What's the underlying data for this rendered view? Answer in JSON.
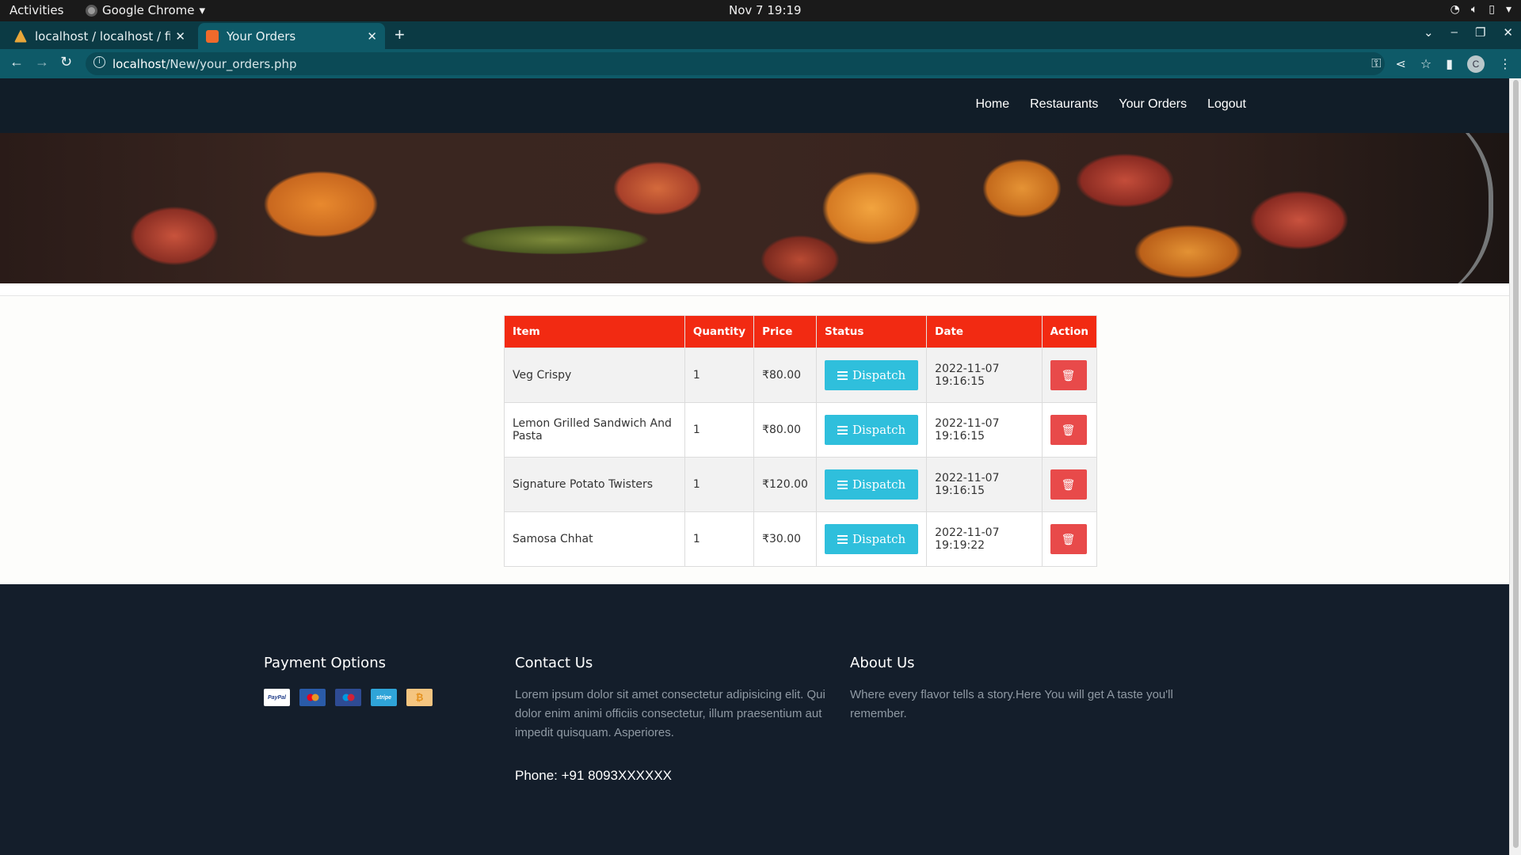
{
  "os_bar": {
    "activities": "Activities",
    "app_name": "Google Chrome",
    "clock": "Nov 7  19:19"
  },
  "browser": {
    "tabs": [
      {
        "title": "localhost / localhost / fin_",
        "active": false
      },
      {
        "title": "Your Orders",
        "active": true
      }
    ],
    "url_host": "localhost",
    "url_path": "/New/your_orders.php"
  },
  "nav": {
    "items": [
      "Home",
      "Restaurants",
      "Your Orders",
      "Logout"
    ]
  },
  "table": {
    "headers": [
      "Item",
      "Quantity",
      "Price",
      "Status",
      "Date",
      "Action"
    ],
    "rows": [
      {
        "item": "Veg Crispy",
        "quantity": "1",
        "price": "₹80.00",
        "status": "Dispatch",
        "date": "2022-11-07 19:16:15"
      },
      {
        "item": "Lemon Grilled Sandwich And Pasta",
        "quantity": "1",
        "price": "₹80.00",
        "status": "Dispatch",
        "date": "2022-11-07 19:16:15"
      },
      {
        "item": "Signature Potato Twisters",
        "quantity": "1",
        "price": "₹120.00",
        "status": "Dispatch",
        "date": "2022-11-07 19:16:15"
      },
      {
        "item": "Samosa Chhat",
        "quantity": "1",
        "price": "₹30.00",
        "status": "Dispatch",
        "date": "2022-11-07 19:19:22"
      }
    ]
  },
  "footer": {
    "payment_title": "Payment Options",
    "payment_cards": [
      {
        "name": "PayPal",
        "color": "#ffffff"
      },
      {
        "name": "mastercard",
        "color": "#2a5ba8"
      },
      {
        "name": "maestro",
        "color": "#2e4b93"
      },
      {
        "name": "stripe",
        "color": "#2fa4d8"
      },
      {
        "name": "bitcoin",
        "color": "#f5c580"
      }
    ],
    "contact_title": "Contact Us",
    "contact_text": "Lorem ipsum dolor sit amet consectetur adipisicing elit. Qui dolor enim animi officiis consectetur, illum praesentium aut impedit quisquam. Asperiores.",
    "phone": "Phone: +91 8093XXXXXX",
    "about_title": "About Us",
    "about_text": "Where every flavor tells a story.Here You will get A taste you'll remember."
  },
  "colors": {
    "table_header": "#f22a12",
    "dispatch_button": "#2fbfdc",
    "delete_button": "#e84a4a",
    "nav_bg": "#111d28",
    "footer_bg": "#141e2b"
  }
}
